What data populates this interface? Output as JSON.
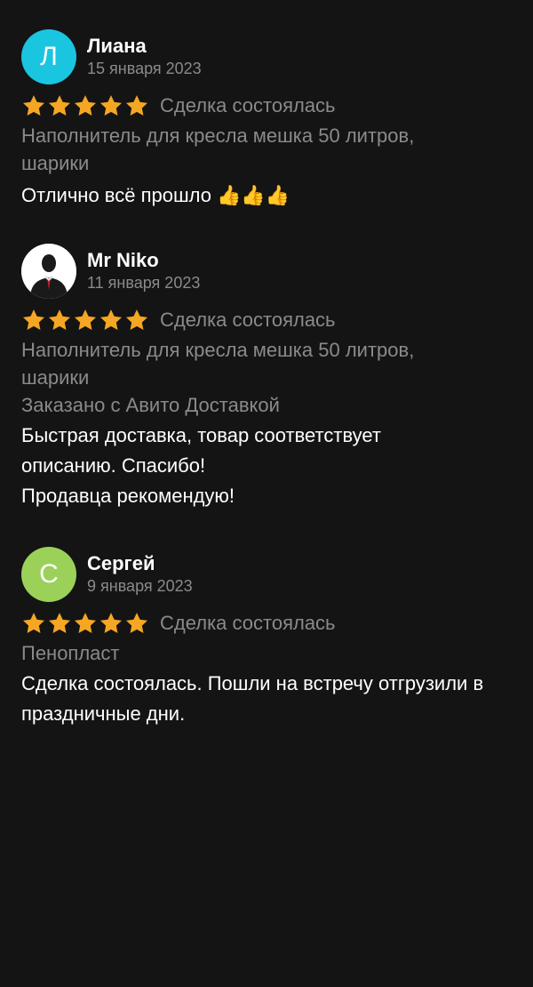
{
  "reviews": [
    {
      "author": "Лиана",
      "avatar_letter": "Л",
      "avatar_color": "#1ac5e0",
      "date": "15 января 2023",
      "rating": 5,
      "deal_status": "Сделка состоялась",
      "item": "Наполнитель для кресла мешка 50 литров, шарики",
      "text": "Отлично всё прошло 👍👍👍"
    },
    {
      "author": "Mr Niko",
      "avatar_icon": "businessman-silhouette-avatar",
      "date": "11 января 2023",
      "rating": 5,
      "deal_status": "Сделка состоялась",
      "item": "Наполнитель для кресла мешка 50 литров, шарики",
      "delivery": "Заказано с Авито Доставкой",
      "text": "Быстрая доставка, товар соответствует описанию. Спасибо!\nПродавца рекомендую!"
    },
    {
      "author": "Сергей",
      "avatar_letter": "С",
      "avatar_color": "#9bd159",
      "date": "9 января 2023",
      "rating": 5,
      "deal_status": "Сделка состоялась",
      "item": "Пенопласт",
      "text": "Сделка состоялась. Пошли на встречу отгрузили в праздничные дни."
    }
  ],
  "colors": {
    "background": "#141414",
    "star": "#f5a623",
    "secondary_text": "#8a8a8a",
    "primary_text": "#ffffff"
  }
}
